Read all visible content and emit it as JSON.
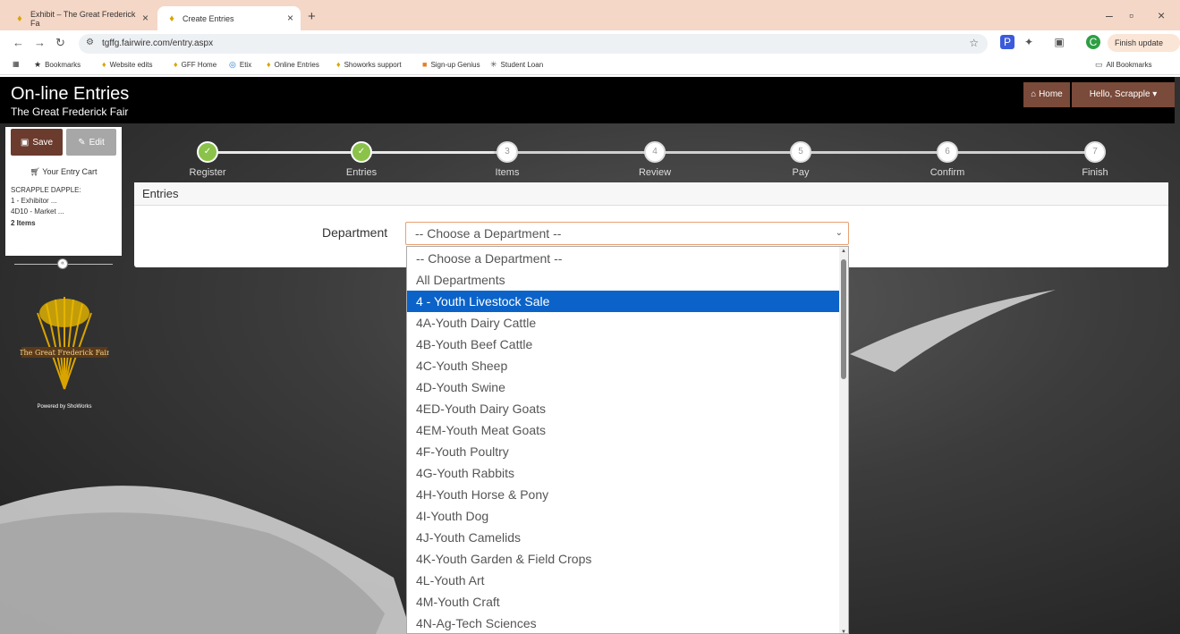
{
  "browser": {
    "tabs": [
      {
        "title": "Exhibit – The Great Frederick Fa"
      },
      {
        "title": "Create Entries"
      }
    ],
    "url": "tgffg.fairwire.com/entry.aspx",
    "finish_update": "Finish update",
    "bookmarks": [
      {
        "label": "Bookmarks"
      },
      {
        "label": "Website edits"
      },
      {
        "label": "GFF Home"
      },
      {
        "label": "Etix"
      },
      {
        "label": "Online Entries"
      },
      {
        "label": "Showorks support"
      },
      {
        "label": "Sign-up Genius"
      },
      {
        "label": "Student Loan"
      }
    ],
    "all_bookmarks": "All Bookmarks"
  },
  "header": {
    "title": "On-line Entries",
    "subtitle": "The Great Frederick Fair",
    "home": "Home",
    "user": "Hello, Scrapple"
  },
  "sidebar": {
    "save": "Save",
    "edit": "Edit",
    "cart_title": "Your Entry Cart",
    "cart_lines": [
      "SCRAPPLE DAPPLE:",
      "1 - Exhibitor ...",
      "4D10 - Market ..."
    ],
    "cart_count": "2 Items",
    "powered_by": "Powered by ShoWorks",
    "logo_text": "The Great Frederick Fair"
  },
  "steps": [
    {
      "label": "Register",
      "num": "1",
      "done": true
    },
    {
      "label": "Entries",
      "num": "2",
      "done": true
    },
    {
      "label": "Items",
      "num": "3",
      "done": false
    },
    {
      "label": "Review",
      "num": "4",
      "done": false
    },
    {
      "label": "Pay",
      "num": "5",
      "done": false
    },
    {
      "label": "Confirm",
      "num": "6",
      "done": false
    },
    {
      "label": "Finish",
      "num": "7",
      "done": false
    }
  ],
  "entries": {
    "heading": "Entries",
    "department_label": "Department",
    "department_value": "-- Choose a Department --"
  },
  "dropdown": {
    "selected_index": 2,
    "options": [
      "-- Choose a Department --",
      "All Departments",
      "4 - Youth Livestock Sale",
      "4A-Youth Dairy Cattle",
      "4B-Youth Beef Cattle",
      "4C-Youth Sheep",
      "4D-Youth Swine",
      "4ED-Youth Dairy Goats",
      "4EM-Youth Meat Goats",
      "4F-Youth Poultry",
      "4G-Youth Rabbits",
      "4H-Youth Horse & Pony",
      "4I-Youth Dog",
      "4J-Youth Camelids",
      "4K-Youth Garden & Field Crops",
      "4L-Youth Art",
      "4M-Youth Craft",
      "4N-Ag-Tech Sciences"
    ]
  },
  "colors": {
    "brand_brown": "#6b3b2e",
    "selection_blue": "#0b63c9",
    "step_done": "#8bc34a"
  }
}
